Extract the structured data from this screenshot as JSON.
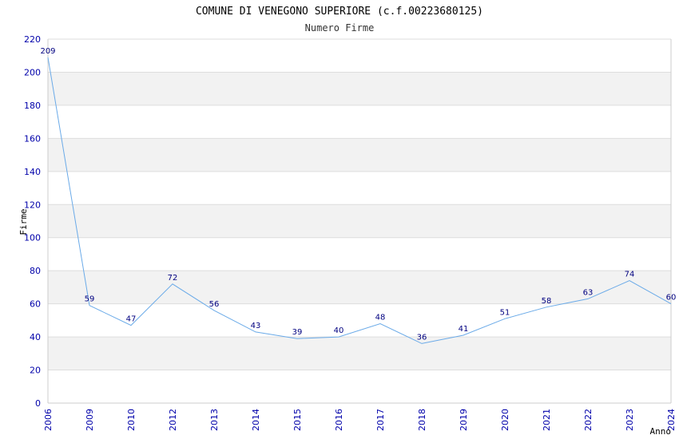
{
  "chart_data": {
    "type": "line",
    "title": "COMUNE DI VENEGONO SUPERIORE (c.f.00223680125)",
    "subtitle": "Numero Firme",
    "xlabel": "Anno",
    "ylabel": "Firme",
    "ylim": [
      0,
      220
    ],
    "ytick_step": 20,
    "grid": true,
    "categories": [
      "2006",
      "2009",
      "2010",
      "2012",
      "2013",
      "2014",
      "2015",
      "2016",
      "2017",
      "2018",
      "2019",
      "2020",
      "2021",
      "2022",
      "2023",
      "2024"
    ],
    "series": [
      {
        "values": [
          209,
          59,
          47,
          72,
          56,
          43,
          39,
          40,
          48,
          36,
          41,
          51,
          58,
          63,
          74,
          60
        ],
        "color": "#6aaae8"
      }
    ]
  },
  "colors": {
    "band": "#f2f2f2",
    "gridline": "#dddddd",
    "axis": "#cccccc",
    "tick_text": "#0000aa",
    "label_text": "#000080"
  }
}
